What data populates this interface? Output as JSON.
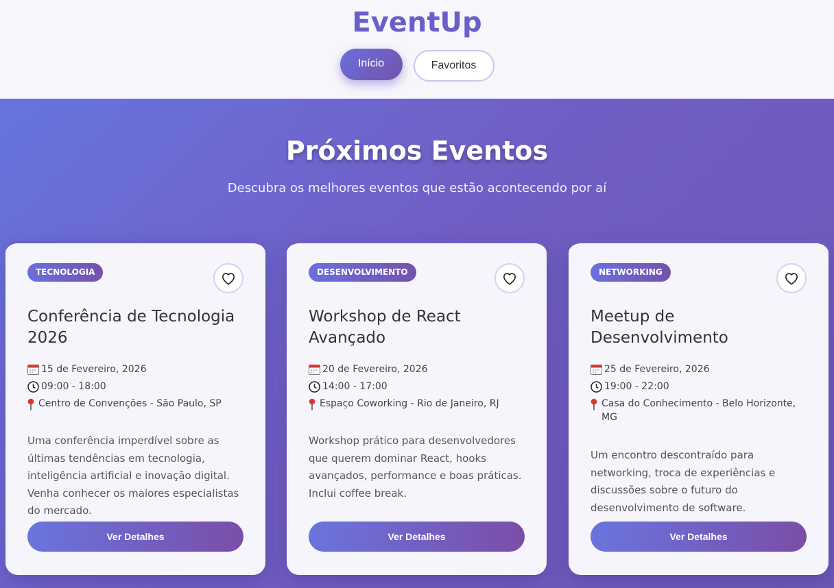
{
  "header": {
    "brand": "EventUp",
    "nav": {
      "home": "Início",
      "favorites": "Favoritos"
    }
  },
  "hero": {
    "title": "Próximos Eventos",
    "subtitle": "Descubra os melhores eventos que estão acontecendo por aí"
  },
  "events": [
    {
      "category": "Tecnologia",
      "title": "Conferência de Tecnologia 2026",
      "date": "15 de Fevereiro, 2026",
      "time": "09:00 - 18:00",
      "location": "Centro de Convenções - São Paulo, SP",
      "description": "Uma conferência imperdível sobre as últimas tendências em tecnologia, inteligência artificial e inovação digital. Venha conhecer os maiores especialistas do mercado.",
      "button": "Ver Detalhes"
    },
    {
      "category": "Desenvolvimento",
      "title": "Workshop de React Avançado",
      "date": "20 de Fevereiro, 2026",
      "time": "14:00 - 17:00",
      "location": "Espaço Coworking - Rio de Janeiro, RJ",
      "description": "Workshop prático para desenvolvedores que querem dominar React, hooks avançados, performance e boas práticas. Inclui coffee break.",
      "button": "Ver Detalhes"
    },
    {
      "category": "Networking",
      "title": "Meetup de Desenvolvimento",
      "date": "25 de Fevereiro, 2026",
      "time": "19:00 - 22:00",
      "location": "Casa do Conhecimento - Belo Horizonte, MG",
      "description": "Um encontro descontraído para networking, troca de experiências e discussões sobre o futuro do desenvolvimento de software.",
      "button": "Ver Detalhes"
    }
  ],
  "icons": {
    "date": "calendar-icon",
    "time": "clock-icon",
    "location": "pin-icon",
    "favorite": "heart-icon"
  },
  "colors": {
    "brand": "#6a5fc8",
    "gradient_start": "#6774de",
    "gradient_end": "#6e58b6"
  }
}
